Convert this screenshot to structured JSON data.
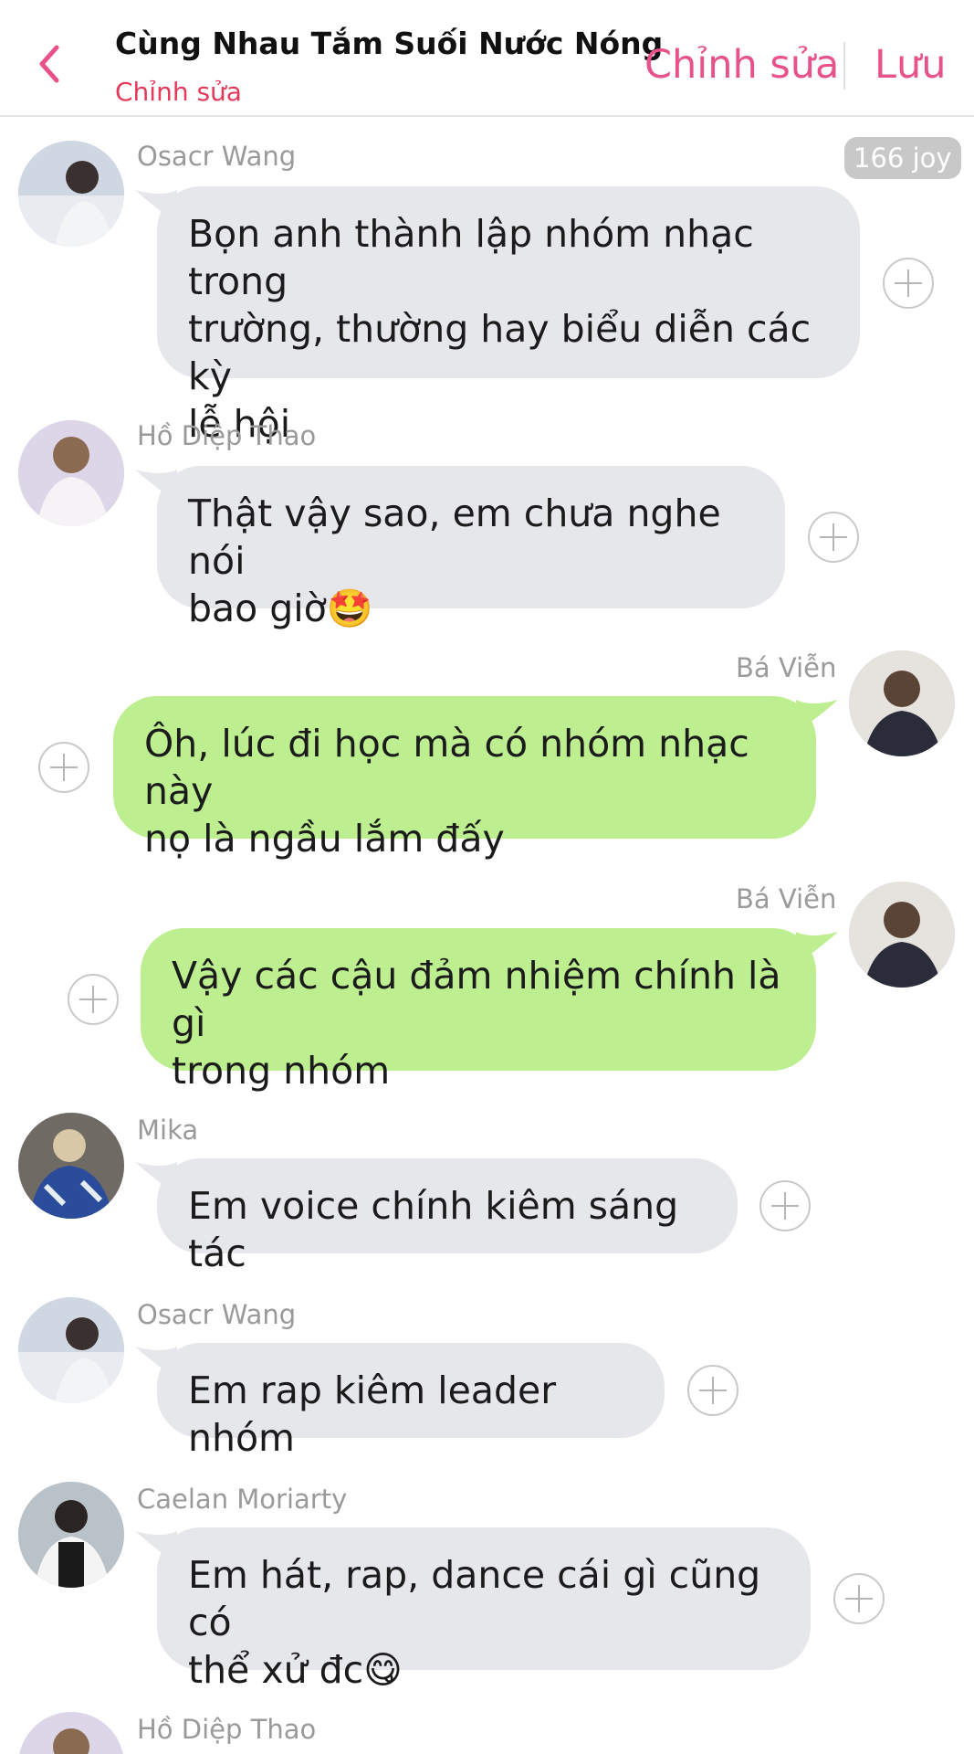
{
  "header": {
    "title": "Cùng Nhau Tắm Suối Nước Nóng",
    "subtitle": "Chỉnh sửa",
    "edit_label": "Chỉnh sửa",
    "save_label": "Lưu",
    "accent_color": "#e8528a"
  },
  "badge": {
    "label": "166 joy"
  },
  "messages": [
    {
      "sender": "Osacr Wang",
      "side": "left",
      "text": "Bọn anh thành lập nhóm nhạc trong\ntrường, thường hay biểu diễn các kỳ\nlễ hội"
    },
    {
      "sender": "Hồ Diệp Thao",
      "side": "left",
      "text": "Thật vậy sao, em chưa nghe nói\nbao giờ🤩"
    },
    {
      "sender": "Bá Viễn",
      "side": "right",
      "text": "Ôh, lúc đi học mà có nhóm nhạc này\nnọ là ngầu lắm đấy"
    },
    {
      "sender": "Bá Viễn",
      "side": "right",
      "text": "Vậy các cậu đảm nhiệm chính là gì\ntrong nhóm"
    },
    {
      "sender": "Mika",
      "side": "left",
      "text": "Em voice chính kiêm sáng tác"
    },
    {
      "sender": "Osacr Wang",
      "side": "left",
      "text": "Em rap kiêm leader nhóm"
    },
    {
      "sender": "Caelan Moriarty",
      "side": "left",
      "text": "Em hát, rap, dance cái gì cũng có\nthể xử đc😋"
    },
    {
      "sender": "Hồ Diệp Thao",
      "side": "left",
      "text": ""
    }
  ],
  "colors": {
    "incoming_bubble": "#e5e7ea",
    "outgoing_bubble": "#bdee8f",
    "sender_text": "#9a9a9a"
  }
}
